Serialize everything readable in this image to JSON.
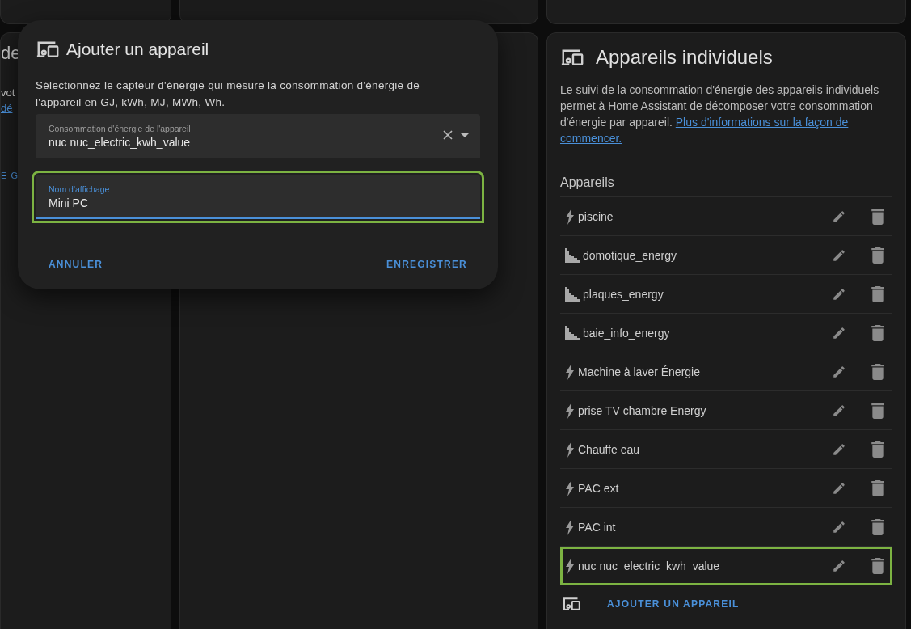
{
  "background_card": {
    "fragments": [
      {
        "kind": "heading",
        "text": "de"
      },
      {
        "kind": "text",
        "text": "vot"
      },
      {
        "kind": "link",
        "text": "dé"
      },
      {
        "kind": "action",
        "text": "E G"
      }
    ]
  },
  "dialog": {
    "title": "Ajouter un appareil",
    "description": "Sélectionnez le capteur d'énergie qui mesure la consommation d'énergie de l'appareil en GJ, kWh, MJ, MWh, Wh.",
    "sensor_field": {
      "label": "Consommation d'énergie de l'appareil",
      "value": "nuc nuc_electric_kwh_value",
      "highlighted": false
    },
    "name_field": {
      "label": "Nom d'affichage",
      "value": "Mini PC",
      "highlighted": true
    },
    "buttons": [
      "ANNULER",
      "ENREGISTRER"
    ]
  },
  "devices_card": {
    "title": "Appareils individuels",
    "description": "Le suivi de la consommation d'énergie des appareils individuels permet à Home Assistant de décomposer votre consommation d'énergie par appareil.",
    "link": [
      "Plus d'informations sur la façon de",
      "commencer."
    ],
    "section": "Appareils",
    "devices": [
      {
        "name": "piscine",
        "kind": "bolt",
        "highlighted": false
      },
      {
        "name": "domotique_energy",
        "kind": "chart",
        "highlighted": false
      },
      {
        "name": "plaques_energy",
        "kind": "chart",
        "highlighted": false
      },
      {
        "name": "baie_info_energy",
        "kind": "chart",
        "highlighted": false
      },
      {
        "name": "Machine à laver Énergie",
        "kind": "bolt",
        "highlighted": false
      },
      {
        "name": "prise TV chambre Energy",
        "kind": "bolt",
        "highlighted": false
      },
      {
        "name": "Chauffe eau",
        "kind": "bolt",
        "highlighted": false
      },
      {
        "name": "PAC ext",
        "kind": "bolt",
        "highlighted": false
      },
      {
        "name": "PAC int",
        "kind": "bolt",
        "highlighted": false
      },
      {
        "name": "nuc nuc_electric_kwh_value",
        "kind": "bolt",
        "highlighted": true
      }
    ],
    "add_button": "AJOUTER UN APPAREIL"
  }
}
